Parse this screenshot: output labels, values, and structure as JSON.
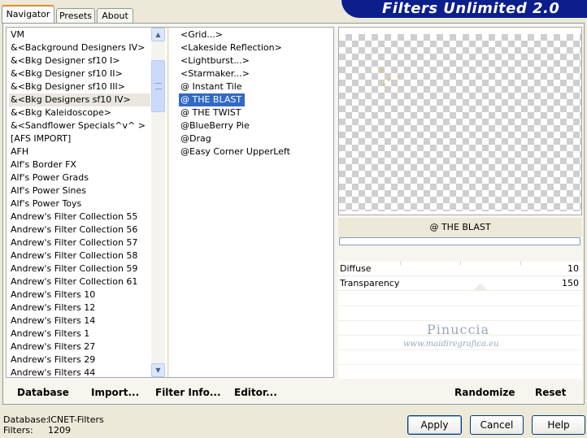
{
  "tabs": [
    {
      "label": "Navigator"
    },
    {
      "label": "Presets"
    },
    {
      "label": "About"
    }
  ],
  "banner_title": "Filters Unlimited 2.0",
  "categories": [
    "VM",
    "&<Background Designers IV>",
    "&<Bkg Designer sf10 I>",
    "&<Bkg Designer sf10 II>",
    "&<Bkg Designer sf10 III>",
    "&<Bkg Designers sf10 IV>",
    "&<Bkg Kaleidoscope>",
    "&<Sandflower Specials^v^ >",
    "[AFS IMPORT]",
    "AFH",
    "Alf's Border FX",
    "Alf's Power Grads",
    "Alf's Power Sines",
    "Alf's Power Toys",
    "Andrew's Filter Collection 55",
    "Andrew's Filter Collection 56",
    "Andrew's Filter Collection 57",
    "Andrew's Filter Collection 58",
    "Andrew's Filter Collection 59",
    "Andrew's Filter Collection 61",
    "Andrew's Filters 10",
    "Andrew's Filters 12",
    "Andrew's Filters 14",
    "Andrew's Filters 1",
    "Andrew's Filters 27",
    "Andrew's Filters 29",
    "Andrew's Filters 44"
  ],
  "selected_category": "&<Bkg Designers sf10 IV>",
  "filters": [
    "<Grid...>",
    "<Lakeside Reflection>",
    "<Lightburst...>",
    "<Starmaker...>",
    "@ Instant Tile",
    "@ THE BLAST",
    "@ THE TWIST",
    "@BlueBerry Pie",
    "@Drag",
    "@Easy Corner UpperLeft"
  ],
  "selected_filter": "@ THE BLAST",
  "preview_filter_name": "@ THE BLAST",
  "params": [
    {
      "label": "Diffuse",
      "value": "10"
    },
    {
      "label": "Transparency",
      "value": "150"
    }
  ],
  "watermark": {
    "line1": "Pinuccia",
    "line2": "www.maidiregrafica.eu"
  },
  "actions": {
    "database": "Database",
    "import": "Import...",
    "filter_info": "Filter Info...",
    "editor": "Editor...",
    "randomize": "Randomize",
    "reset": "Reset"
  },
  "status": {
    "database_label": "Database:",
    "database_value": "ICNET-Filters",
    "filters_label": "Filters:",
    "filters_value": "1209"
  },
  "buttons": {
    "apply": "Apply",
    "cancel": "Cancel",
    "help": "Help"
  },
  "colors": {
    "banner": "#0b1e8c",
    "selection": "#316ac5",
    "tab_accent": "#e68b2c"
  }
}
